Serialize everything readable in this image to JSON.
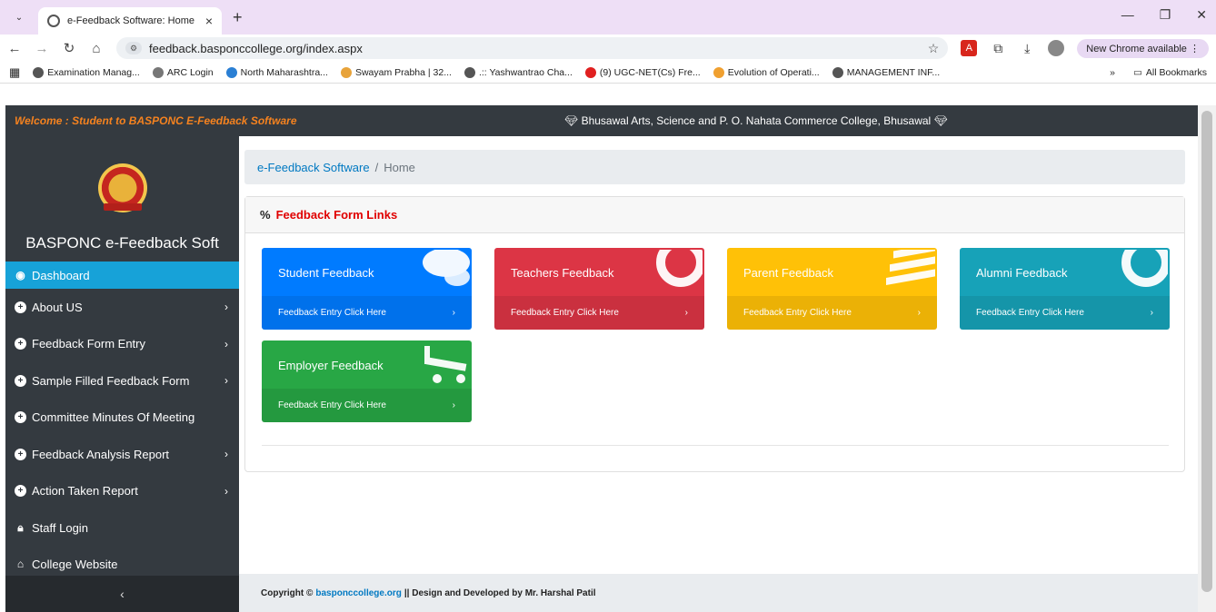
{
  "browser": {
    "tab_title": "e-Feedback Software: Home",
    "url": "feedback.basponccollege.org/index.aspx",
    "new_chrome": "New Chrome available",
    "bookmarks": [
      {
        "label": "Examination Manag...",
        "color": "#555555"
      },
      {
        "label": "ARC Login",
        "color": "#777777"
      },
      {
        "label": "North Maharashtra...",
        "color": "#2a7fd4"
      },
      {
        "label": "Swayam Prabha | 32...",
        "color": "#e8a33a"
      },
      {
        "label": ".:: Yashwantrao Cha...",
        "color": "#555555"
      },
      {
        "label": "(9) UGC-NET(Cs) Fre...",
        "color": "#e02020"
      },
      {
        "label": "Evolution of Operati...",
        "color": "#f0a030"
      },
      {
        "label": "MANAGEMENT INF...",
        "color": "#555555"
      }
    ],
    "all_bookmarks": "All Bookmarks"
  },
  "topnav": {
    "welcome": "Welcome : Student to BASPONC E-Feedback Software",
    "college": "Bhusawal Arts, Science and P. O. Nahata Commerce College, Bhusawal"
  },
  "sidebar": {
    "brand": "BASPONC e-Feedback Soft",
    "items": [
      {
        "label": "Dashboard",
        "chevron": false,
        "icon": "dashboard-icon"
      },
      {
        "label": "About US",
        "chevron": true,
        "icon": "plus-circle-icon"
      },
      {
        "label": "Feedback Form Entry",
        "chevron": true,
        "icon": "plus-circle-icon"
      },
      {
        "label": "Sample Filled Feedback Form",
        "chevron": true,
        "icon": "plus-circle-icon"
      },
      {
        "label": "Committee Minutes Of Meeting",
        "chevron": false,
        "icon": "plus-circle-icon"
      },
      {
        "label": "Feedback Analysis Report",
        "chevron": true,
        "icon": "plus-circle-icon"
      },
      {
        "label": "Action Taken Report",
        "chevron": true,
        "icon": "plus-circle-icon"
      },
      {
        "label": "Staff Login",
        "chevron": false,
        "icon": "lock-icon"
      },
      {
        "label": "College Website",
        "chevron": false,
        "icon": "home-icon"
      }
    ]
  },
  "breadcrumb": {
    "link": "e-Feedback Software",
    "current": "Home",
    "separator": "/"
  },
  "card": {
    "title": "Feedback Form Links",
    "tiles": [
      {
        "title": "Student Feedback",
        "footer": "Feedback Entry Click Here",
        "color": "#007bff",
        "icon": "comments-icon"
      },
      {
        "title": "Teachers Feedback",
        "footer": "Feedback Entry Click Here",
        "color": "#dc3545",
        "icon": "life-ring-icon"
      },
      {
        "title": "Parent Feedback",
        "footer": "Feedback Entry Click Here",
        "color": "#ffc107",
        "icon": "list-icon"
      },
      {
        "title": "Alumni Feedback",
        "footer": "Feedback Entry Click Here",
        "color": "#17a2b8",
        "icon": "life-ring-icon"
      },
      {
        "title": "Employer Feedback",
        "footer": "Feedback Entry Click Here",
        "color": "#28a745",
        "icon": "cart-icon"
      }
    ]
  },
  "footer": {
    "prefix": "Copyright ©",
    "link": "basponccollege.org",
    "suffix": "|| Design and Developed by Mr. Harshal Patil"
  }
}
